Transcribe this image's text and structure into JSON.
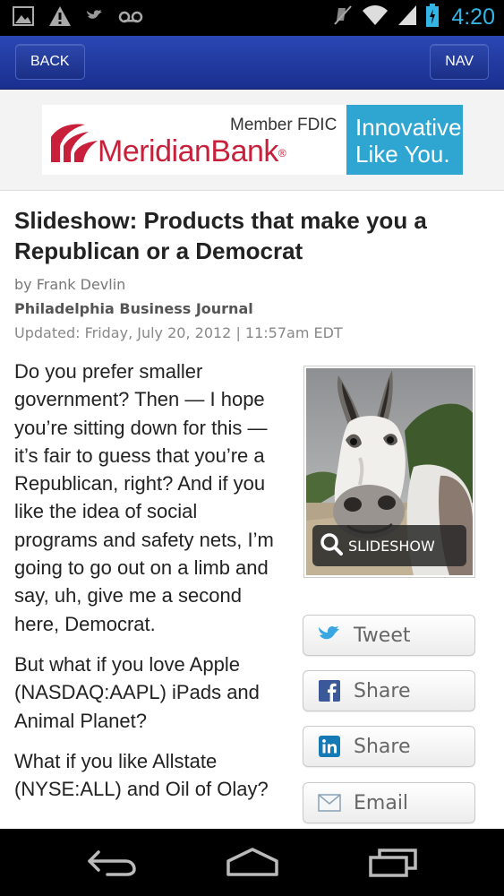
{
  "status_bar": {
    "time": "4:20",
    "icons": [
      "image-icon",
      "warning-icon",
      "twitter-bird-icon",
      "voicemail-icon",
      "mute-icon",
      "wifi-icon",
      "signal-icon",
      "battery-charging-icon"
    ],
    "accent_color": "#33b5e5"
  },
  "header": {
    "back_label": "BACK",
    "nav_label": "NAV",
    "color": "#1f3a9e"
  },
  "ad": {
    "fdic": "Member FDIC",
    "brand": "MeridianBank",
    "registered": "®",
    "tagline_1": "Innovative.",
    "tagline_2": "Like You.",
    "brand_color": "#c8203b",
    "accent_color": "#2fa6d2"
  },
  "article": {
    "title": "Slideshow: Products that make you a Republican or a Democrat",
    "byline": "by Frank Devlin",
    "publication": "Philadelphia Business Journal",
    "updated": "Updated: Friday, July 20, 2012 | 11:57am EDT",
    "paragraphs": [
      "Do you prefer smaller government? Then — I hope you’re sitting down for this — it’s fair to guess that you’re a Republican, right? And if you like the idea of social programs and safety nets, I’m going to go out on a limb and say, uh, give me a second here, Democrat.",
      "But what if you love Apple (NASDAQ:AAPL) iPads and Animal Planet?",
      "What if you like Allstate (NYSE:ALL) and Oil of Olay?"
    ],
    "slideshow_label": "SLIDESHOW"
  },
  "share": {
    "tweet": "Tweet",
    "facebook_share": "Share",
    "linkedin_share": "Share",
    "email": "Email"
  },
  "nav_bar": {
    "icons": [
      "back-nav-icon",
      "home-nav-icon",
      "recent-apps-icon"
    ]
  }
}
